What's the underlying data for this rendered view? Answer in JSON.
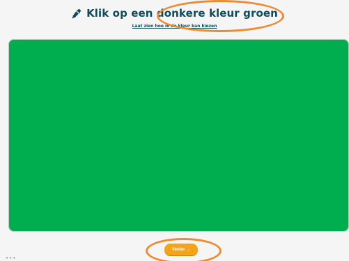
{
  "header": {
    "title": "Klik op een donkere kleur groen",
    "title_icon": "eyedropper-icon",
    "help_link": "Laat zien hoe ik de kleur kan kiezen"
  },
  "color_panel": {
    "color": "#00ad4f"
  },
  "footer": {
    "continue_label": "Verder →",
    "continue_color": "#f4a416"
  },
  "misc": {
    "corner_dots": "•••"
  },
  "colors": {
    "title_text": "#0f4d5a",
    "annotation": "#ef8a2f",
    "background": "#f5f5f6"
  }
}
